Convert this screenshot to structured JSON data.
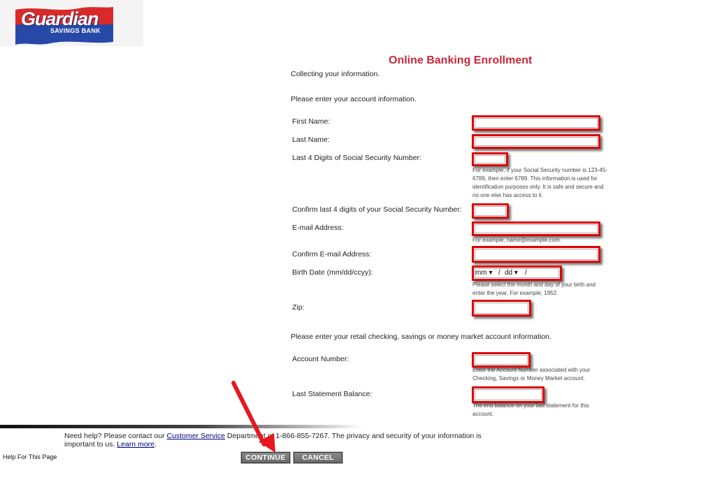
{
  "brand": {
    "name": "Guardian",
    "sub": "SAVINGS BANK"
  },
  "page_title": "Online Banking Enrollment",
  "intro": "Collecting your information.",
  "section1": "Please enter your account information.",
  "section2": "Please enter your retail checking, savings or money market account information.",
  "fields": {
    "first_name": "First Name:",
    "last_name": "Last Name:",
    "ssn4": "Last 4 Digits of Social Security Number:",
    "ssn4_help_1": "For example, if your Social Security number is 123-45-",
    "ssn4_help_2": "6789, then enter 6789. This information is used for",
    "ssn4_help_3": "identification purposes only. It is safe and secure and",
    "ssn4_help_4": "no one else has access to it.",
    "ssn4_confirm": "Confirm last 4 digits of your Social Security Number:",
    "email": "E-mail Address:",
    "email_help": "For example, name@example.com.",
    "email_confirm": "Confirm E-mail Address:",
    "birth": "Birth Date (mm/dd/ccyy):",
    "birth_mm": "mm ▾",
    "birth_dd": "dd ▾",
    "birth_help_1": "Please select the month and day of your birth and",
    "birth_help_2": "enter the year. For example, 1952.",
    "zip": "Zip:",
    "account": "Account Number:",
    "account_help_1": "Enter the Account Number associated with your",
    "account_help_2": "Checking, Savings or Money Market account.",
    "balance": "Last Statement Balance:",
    "balance_help_1": "The end balance on your last statement for this",
    "balance_help_2": "account."
  },
  "footer": {
    "pre": "Need help? Please contact our ",
    "link": "Customer Service",
    "post": " Department at 1-866-855-7267. The privacy and security of your information is",
    "line2": "important to us. ",
    "learn": "Learn more",
    "dot": "."
  },
  "help_page": "Help For This Page",
  "buttons": {
    "continue": "CONTINUE",
    "cancel": "CANCEL"
  },
  "colors": {
    "title": "#c8283a",
    "highlight": "#dd0000",
    "arrow": "#e8161e"
  }
}
